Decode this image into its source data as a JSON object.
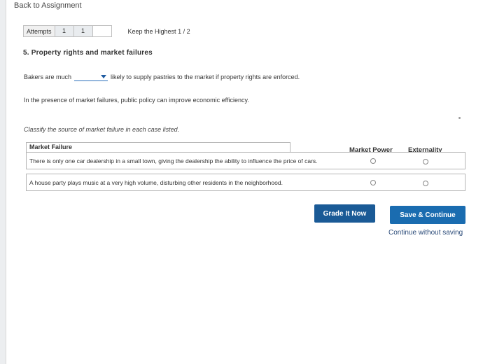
{
  "nav": {
    "back_label": "Back to Assignment"
  },
  "attempts": {
    "label": "Attempts",
    "boxes": [
      "1",
      "1",
      ""
    ],
    "keep_label": "Keep the Highest 1 / 2"
  },
  "question": {
    "title": "5. Property rights and market failures",
    "sentence_before": "Bakers are much",
    "dropdown_value": "",
    "sentence_after": "likely to supply pastries to the market if property rights are enforced.",
    "policy_text": "In the presence of market failures, public policy can improve economic efficiency.",
    "instruction": "Classify the source of market failure in each case listed."
  },
  "table": {
    "header": "Market Failure",
    "columns": [
      "Market Power",
      "Externality"
    ],
    "rows": [
      {
        "text": "There is only one car dealership in a small town, giving the dealership the ability to influence the price of cars.",
        "selected": null
      },
      {
        "text": "A house party plays music at a very high volume, disturbing other residents in the neighborhood.",
        "selected": null
      }
    ]
  },
  "actions": {
    "grade_label": "Grade It Now",
    "save_label": "Save & Continue",
    "continue_label": "Continue without saving"
  },
  "colors": {
    "primary": "#1a6cb0",
    "grade": "#1a5a96",
    "dropdown": "#2a6ebb"
  }
}
